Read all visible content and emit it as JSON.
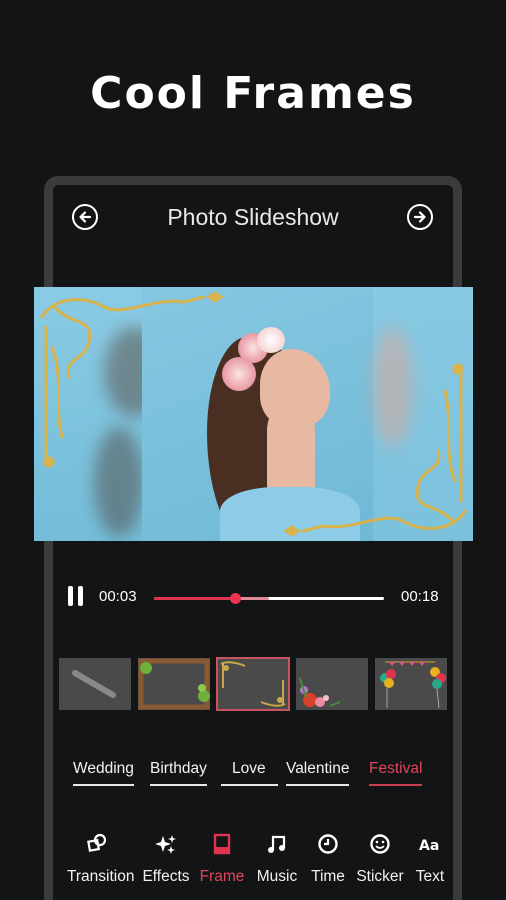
{
  "promo": {
    "headline": "Cool Frames"
  },
  "app": {
    "title": "Photo Slideshow",
    "back_icon": "arrow-left-circle-icon",
    "forward_icon": "arrow-right-circle-icon"
  },
  "player": {
    "state": "playing",
    "pause_icon": "pause-icon",
    "current_time": "00:03",
    "total_time": "00:18",
    "progress_percent": 35,
    "buffered_percent": 50,
    "accent_color": "#e0344e"
  },
  "frames": {
    "selected_index": 2,
    "items": [
      {
        "name": "none",
        "icon": "no-frame-icon"
      },
      {
        "name": "wooden-vine"
      },
      {
        "name": "golden-ornament"
      },
      {
        "name": "floral"
      },
      {
        "name": "balloons"
      }
    ]
  },
  "categories": {
    "active_index": 4,
    "items": [
      {
        "label": "Wedding"
      },
      {
        "label": "Birthday"
      },
      {
        "label": "Love"
      },
      {
        "label": "Valentine"
      },
      {
        "label": "Festival"
      }
    ]
  },
  "toolbar": {
    "active_index": 2,
    "items": [
      {
        "label": "Transition",
        "icon": "transition-shapes-icon"
      },
      {
        "label": "Effects",
        "icon": "sparkles-icon"
      },
      {
        "label": "Frame",
        "icon": "frame-icon"
      },
      {
        "label": "Music",
        "icon": "music-note-icon"
      },
      {
        "label": "Time",
        "icon": "clock-icon"
      },
      {
        "label": "Sticker",
        "icon": "smiley-icon"
      },
      {
        "label": "Text",
        "icon": "text-aa-icon"
      }
    ]
  },
  "colors": {
    "accent": "#e0465a",
    "background": "#131416",
    "bezel": "#3a3b3d"
  }
}
